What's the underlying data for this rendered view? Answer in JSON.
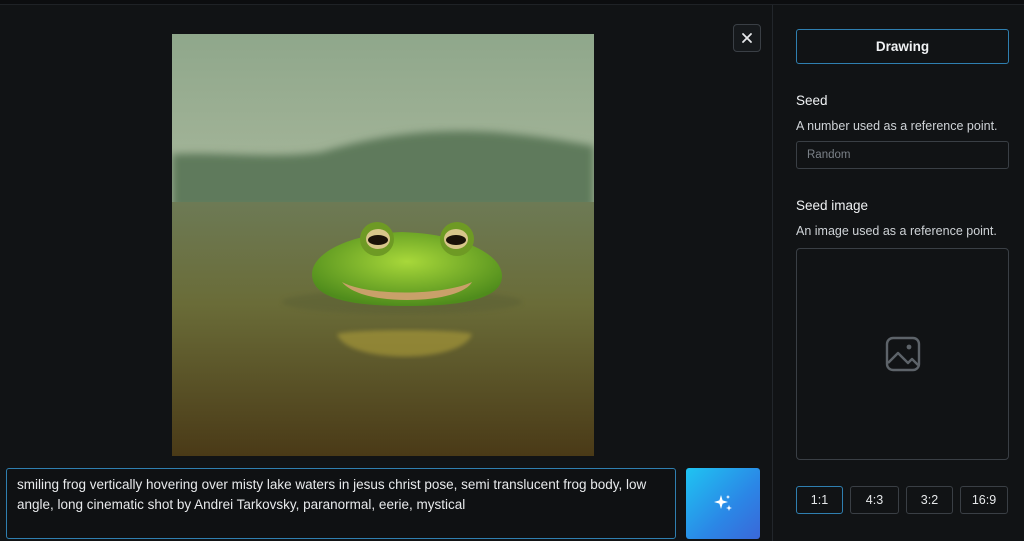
{
  "icons": {
    "close": "close-icon",
    "generate": "sparkles-icon",
    "image_placeholder": "image-icon"
  },
  "prompt": {
    "value": "smiling frog vertically hovering over misty lake waters in jesus christ pose, semi translucent frog body, low angle, long cinematic shot by Andrei Tarkovsky, paranormal, eerie, mystical"
  },
  "sidebar": {
    "mode_label": "Drawing",
    "seed": {
      "title": "Seed",
      "description": "A number used as a reference point.",
      "placeholder": "Random",
      "value": ""
    },
    "seed_image": {
      "title": "Seed image",
      "description": "An image used as a reference point."
    },
    "aspect_ratios": [
      {
        "label": "1:1",
        "active": true
      },
      {
        "label": "4:3",
        "active": false
      },
      {
        "label": "3:2",
        "active": false
      },
      {
        "label": "16:9",
        "active": false
      }
    ]
  },
  "colors": {
    "accent_border": "#2f7fb0",
    "generate_gradient_start": "#1fc4f2",
    "generate_gradient_end": "#3a67d8",
    "background": "#111315"
  }
}
